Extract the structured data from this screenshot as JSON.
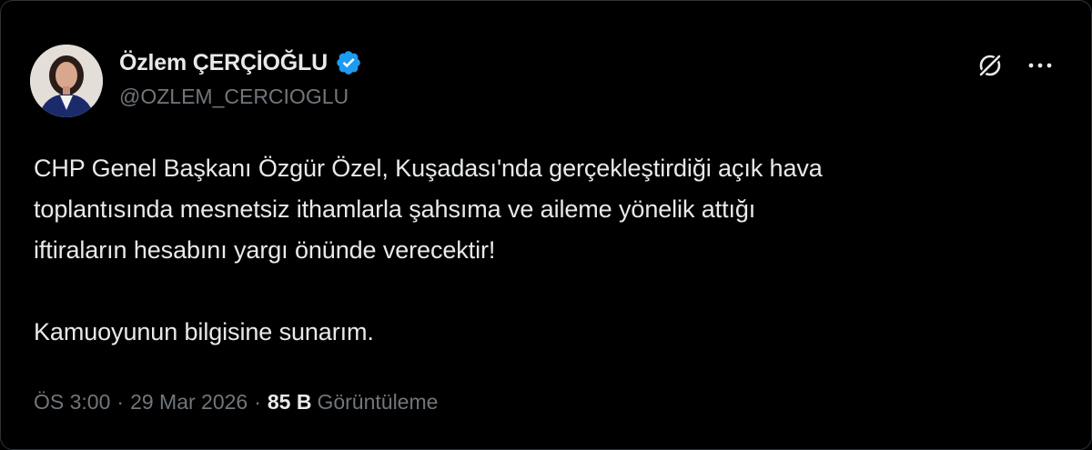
{
  "user": {
    "display_name": "Özlem ÇERÇİOĞLU",
    "handle": "@OZLEM_CERCIOGLU",
    "verified": true,
    "verified_color": "#1d9bf0"
  },
  "actions": {
    "grok_icon": "grok-icon",
    "more_label": "···"
  },
  "tweet": {
    "text": "CHP Genel Başkanı Özgür Özel, Kuşadası'nda gerçekleştirdiği açık hava\ntoplantısında mesnetsiz ithamlarla şahsıma ve aileme yönelik attığı\niftiraların hesabını yargı önünde verecektir!\n\nKamuoyunun bilgisine sunarım."
  },
  "meta": {
    "time": "ÖS 3:00",
    "separator": "·",
    "date": "29 Mar 2026",
    "views_count": "85 B",
    "views_label": "Görüntüleme"
  },
  "colors": {
    "background": "#000000",
    "primary_text": "#e7e9ea",
    "secondary_text": "#71767b",
    "accent": "#1d9bf0"
  }
}
